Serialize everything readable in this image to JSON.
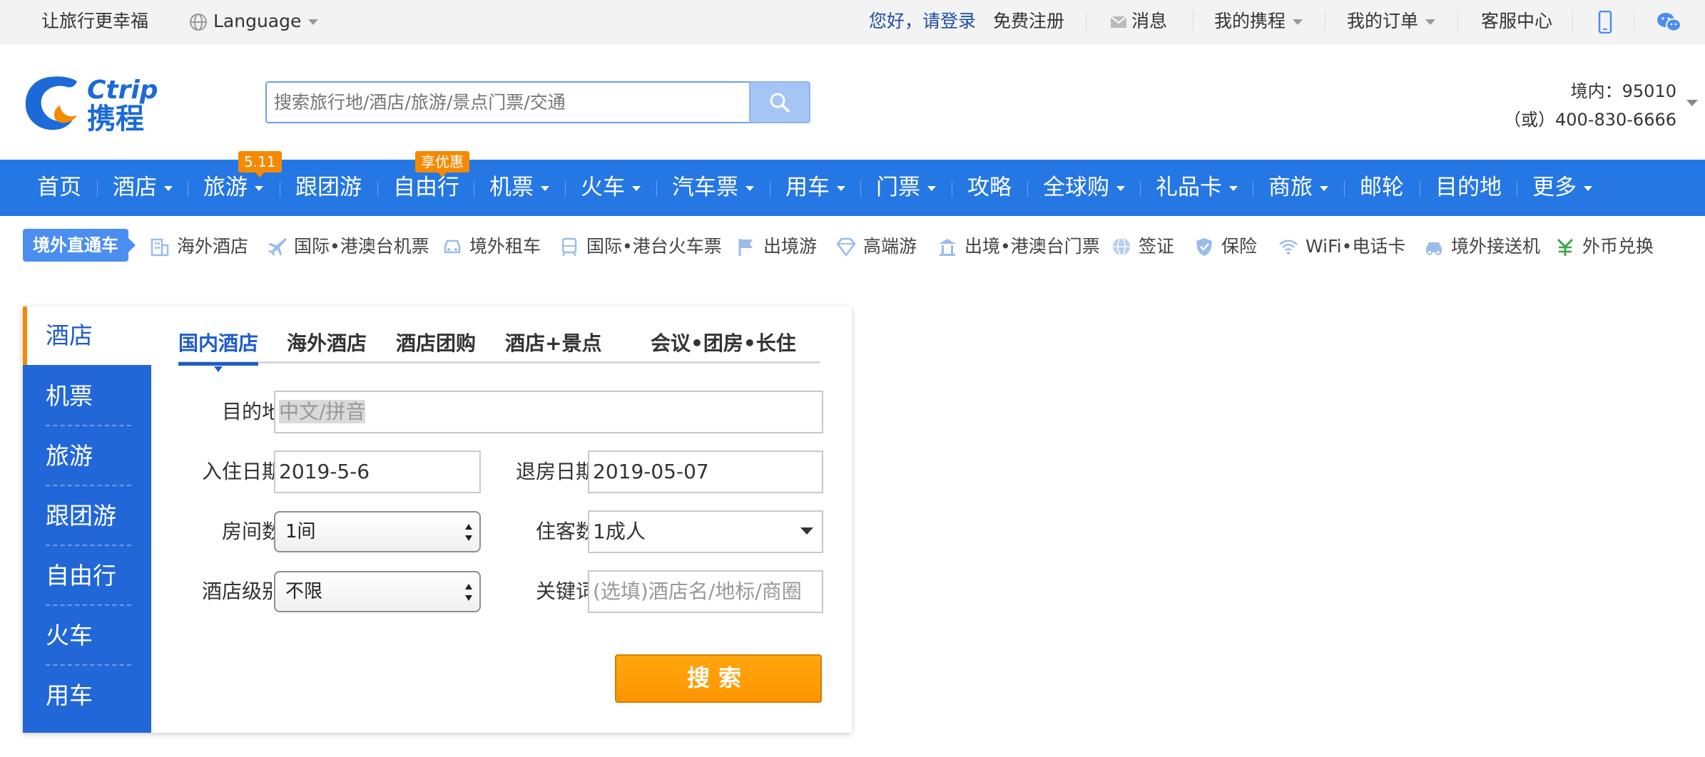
{
  "topbar": {
    "slogan": "让旅行更幸福",
    "language": "Language",
    "greeting": "您好，请登录",
    "register": "免费注册",
    "messages": "消息",
    "my_ctrip": "我的携程",
    "my_orders": "我的订单",
    "service": "客服中心"
  },
  "header": {
    "logo_en": "Ctrip",
    "logo_cn": "携程",
    "search_placeholder": "搜索旅行地/酒店/旅游/景点门票/交通",
    "hotline_1": "境内：95010",
    "hotline_2": "（或）400-830-6666"
  },
  "mainnav": {
    "items": [
      "首页",
      "酒店",
      "旅游",
      "跟团游",
      "自由行",
      "机票",
      "火车",
      "汽车票",
      "用车",
      "门票",
      "攻略",
      "全球购",
      "礼品卡",
      "商旅",
      "邮轮",
      "目的地",
      "更多"
    ],
    "badge_travel": "5.11",
    "badge_free": "享优惠"
  },
  "subnav": {
    "tag": "境外直通车",
    "items": [
      "海外酒店",
      "国际•港澳台机票",
      "境外租车",
      "国际•港台火车票",
      "出境游",
      "高端游",
      "出境•港澳台门票",
      "签证",
      "保险",
      "WiFi•电话卡",
      "境外接送机",
      "外币兑换"
    ]
  },
  "side": {
    "active": "酒店",
    "items": [
      "机票",
      "旅游",
      "跟团游",
      "自由行",
      "火车",
      "用车"
    ]
  },
  "tabs": [
    "国内酒店",
    "海外酒店",
    "酒店团购",
    "酒店+景点",
    "会议•团房•长住"
  ],
  "form": {
    "dest_label": "目的地",
    "dest_placeholder": "中文/拼音",
    "checkin_label": "入住日期",
    "checkin_value": "2019-5-6",
    "checkout_label": "退房日期",
    "checkout_value": "2019-05-07",
    "rooms_label": "房间数",
    "rooms_value": "1间",
    "guests_label": "住客数",
    "guests_value": "1成人",
    "level_label": "酒店级别",
    "level_value": "不限",
    "keyword_label": "关键词",
    "keyword_placeholder": "(选填)酒店名/地标/商圈",
    "search_button": "搜索"
  },
  "colors": {
    "brand_blue": "#2577e3",
    "side_blue": "#2267d8",
    "accent_orange": "#ff9500"
  }
}
